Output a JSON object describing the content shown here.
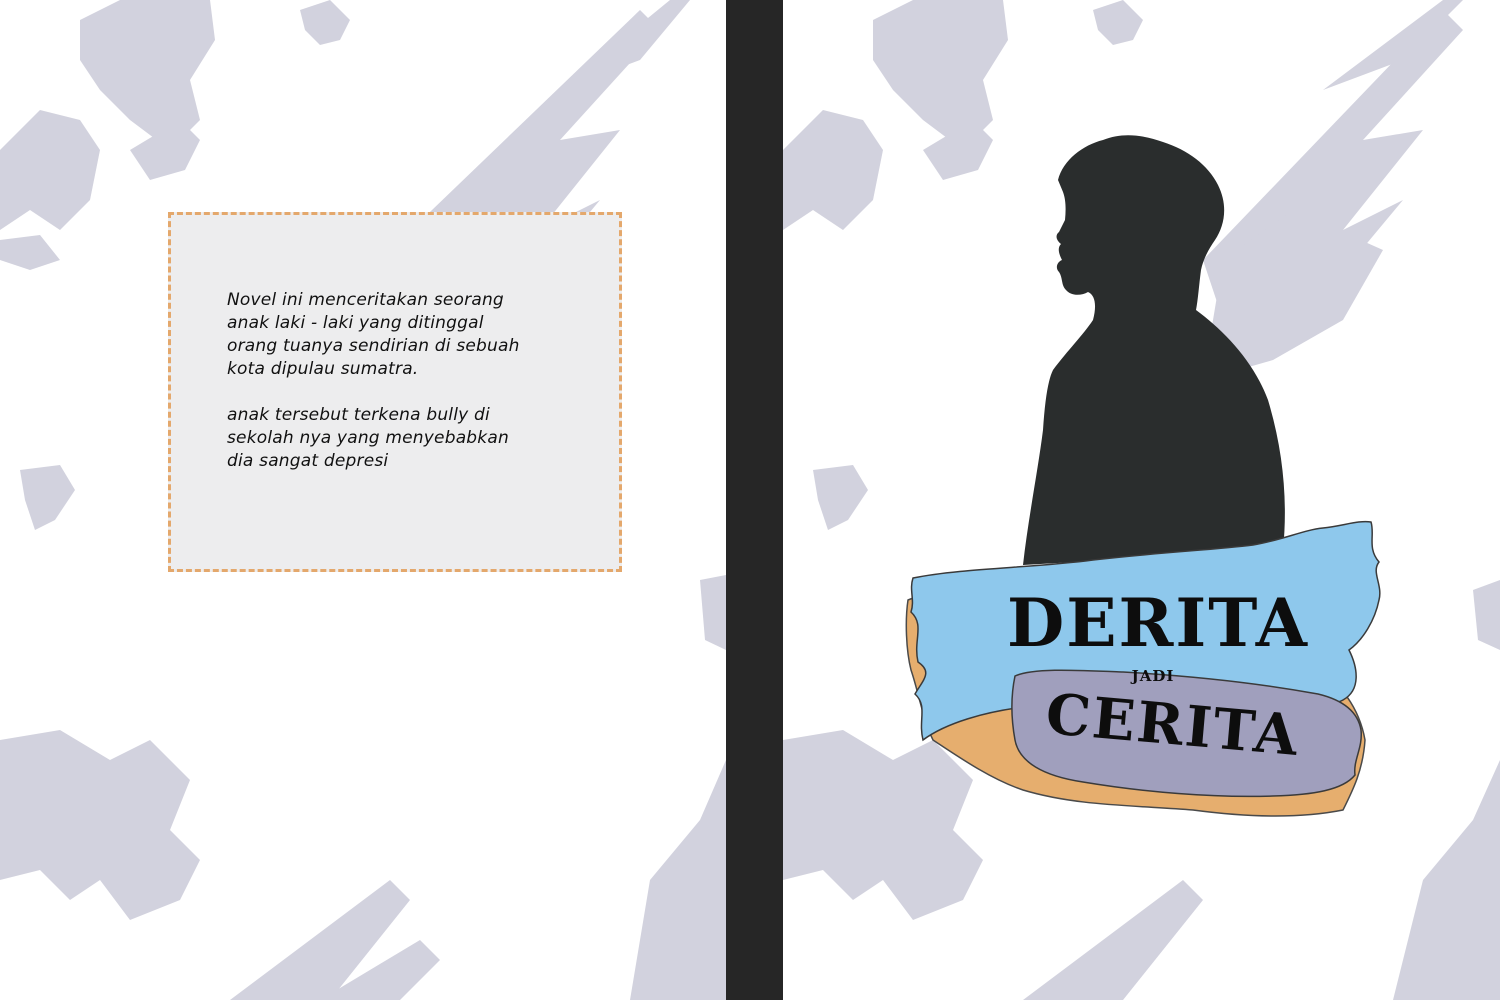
{
  "back_cover": {
    "synopsis_paragraph_1": "Novel ini menceritakan seorang\nanak laki - laki yang ditinggal\norang tuanya sendirian di sebuah\nkota dipulau sumatra.",
    "synopsis_paragraph_2": "anak tersebut terkena bully di\nsekolah nya yang menyebabkan\ndia sangat depresi"
  },
  "front_cover": {
    "title_line_1": "DERITA",
    "title_connector": "JADI",
    "title_line_2": "CERITA"
  },
  "colors": {
    "page_background": "#ffffff",
    "pattern_splash": "#d2d2de",
    "spine": "#262626",
    "silhouette": "#2a2d2d",
    "banner_blue": "#8ec8ec",
    "banner_orange": "#e6ae6e",
    "banner_purple": "#a09fbd",
    "synopsis_box_fill": "#ededee",
    "synopsis_box_border": "#e4a86c"
  },
  "icons": {
    "silhouette": "person-silhouette-icon",
    "splash": "paint-splash-icon"
  }
}
